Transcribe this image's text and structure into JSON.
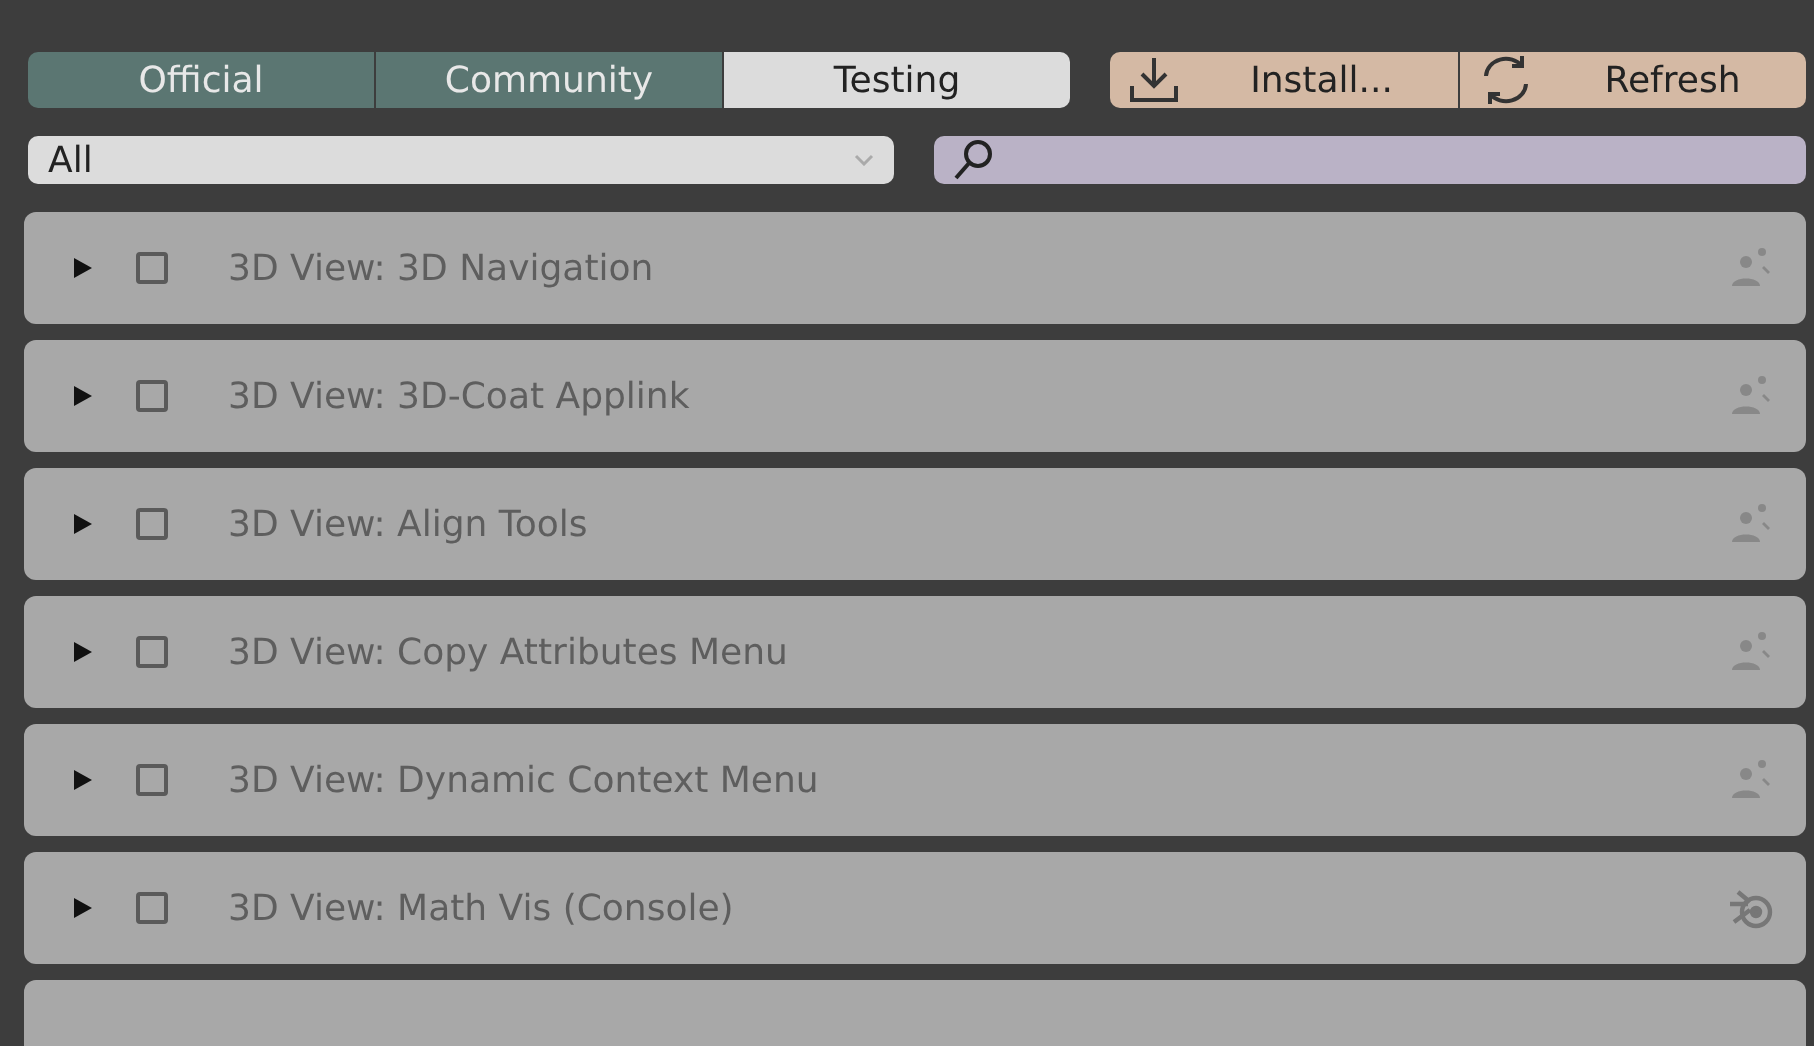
{
  "support_tabs": [
    {
      "label": "Official",
      "selected": true
    },
    {
      "label": "Community",
      "selected": true
    },
    {
      "label": "Testing",
      "selected": false
    }
  ],
  "actions": [
    {
      "label": "Install...",
      "kind": "install"
    },
    {
      "label": "Refresh",
      "kind": "refresh"
    }
  ],
  "category_dropdown": {
    "value": "All"
  },
  "addons": [
    {
      "name": "3D View: 3D Navigation",
      "expanded": false,
      "checked": false,
      "kind": "community"
    },
    {
      "name": "3D View: 3D-Coat Applink",
      "expanded": false,
      "checked": false,
      "kind": "community"
    },
    {
      "name": "3D View: Align Tools",
      "expanded": false,
      "checked": false,
      "kind": "community"
    },
    {
      "name": "3D View: Copy Attributes Menu",
      "expanded": false,
      "checked": false,
      "kind": "community"
    },
    {
      "name": "3D View: Dynamic Context Menu",
      "expanded": false,
      "checked": false,
      "kind": "community"
    },
    {
      "name": "3D View: Math Vis (Console)",
      "expanded": false,
      "checked": false,
      "kind": "official"
    }
  ]
}
